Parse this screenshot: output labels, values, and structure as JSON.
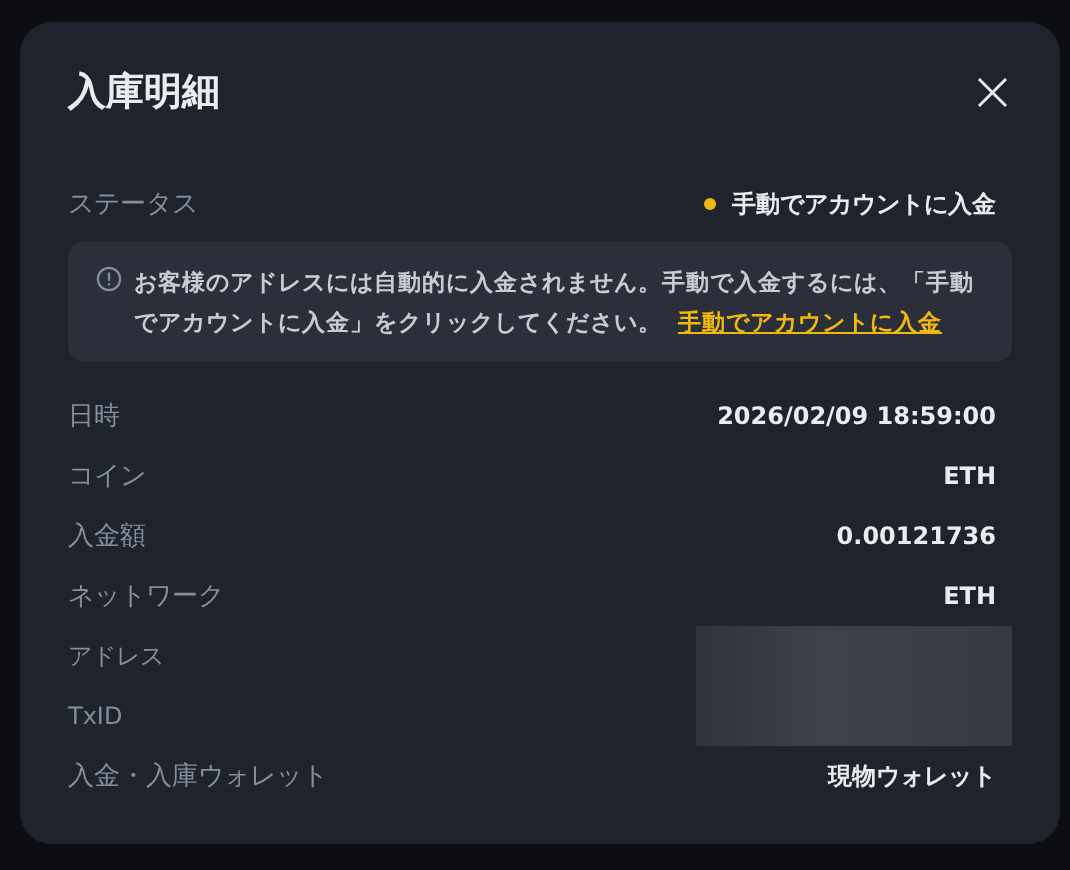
{
  "dialog": {
    "title": "入庫明細",
    "close": "×"
  },
  "status": {
    "label": "ステータス",
    "value": "手動でアカウントに入金",
    "color": "#f0b90b"
  },
  "notice": {
    "text": "お客様のアドレスには自動的に入金されません。手動で入金するには、「手動でアカウントに入金」をクリックしてください。",
    "link": "手動でアカウントに入金"
  },
  "details": [
    {
      "label": "日時",
      "kind": "text",
      "value": "2026/02/09 18:59:00"
    },
    {
      "label": "コイン",
      "kind": "text",
      "value": "ETH"
    },
    {
      "label": "入金額",
      "kind": "text",
      "value": "0.00121736"
    },
    {
      "label": "ネットワーク",
      "kind": "text",
      "value": "ETH"
    },
    {
      "label": "アドレス",
      "kind": "redacted"
    },
    {
      "label": "TxID",
      "kind": "redacted"
    },
    {
      "label": "入金・入庫ウォレット",
      "kind": "text",
      "value": "現物ウォレット"
    }
  ]
}
